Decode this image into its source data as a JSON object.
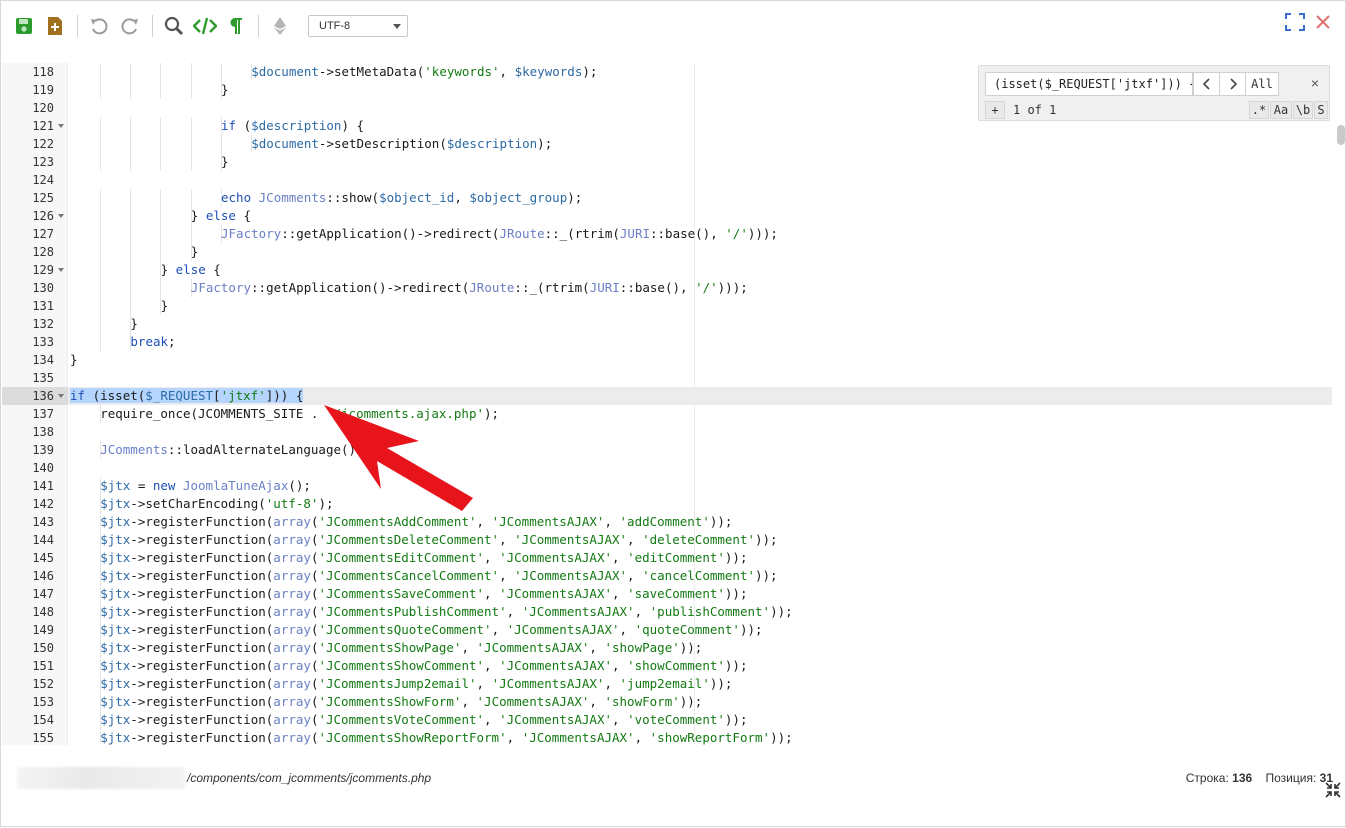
{
  "toolbar": {
    "save_icon": "save-icon",
    "new_file_icon": "new-file-icon",
    "undo_icon": "undo-icon",
    "redo_icon": "redo-icon",
    "search_icon": "search-icon",
    "code_icon": "code-icon",
    "pilcrow_icon": "pilcrow-icon",
    "encoding": "UTF-8",
    "colors": {
      "green": "#2e9b2e",
      "brown": "#a0701f",
      "gray": "#9a9a9a"
    }
  },
  "search": {
    "value": "(isset($_REQUEST['jtxf'])) {",
    "prev": "<",
    "next": ">",
    "all": "All",
    "close": "×",
    "add": "+",
    "counter": "1 of 1",
    "regex": ".*",
    "case": "Aa",
    "word": "\\b",
    "selection": "S"
  },
  "editor": {
    "lines": [
      {
        "n": "118",
        "fold": false,
        "indent": 6,
        "code": "$document->setMetaData('keywords', $keywords);"
      },
      {
        "n": "119",
        "fold": false,
        "indent": 5,
        "code": "}"
      },
      {
        "n": "120",
        "fold": false,
        "indent": 0,
        "code": ""
      },
      {
        "n": "121",
        "fold": true,
        "indent": 5,
        "code": "if ($description) {"
      },
      {
        "n": "122",
        "fold": false,
        "indent": 6,
        "code": "$document->setDescription($description);"
      },
      {
        "n": "123",
        "fold": false,
        "indent": 5,
        "code": "}"
      },
      {
        "n": "124",
        "fold": false,
        "indent": 0,
        "code": ""
      },
      {
        "n": "125",
        "fold": false,
        "indent": 5,
        "code": "echo JComments::show($object_id, $object_group);"
      },
      {
        "n": "126",
        "fold": true,
        "indent": 4,
        "code": "} else {"
      },
      {
        "n": "127",
        "fold": false,
        "indent": 5,
        "code": "JFactory::getApplication()->redirect(JRoute::_(rtrim(JURI::base(), '/')));"
      },
      {
        "n": "128",
        "fold": false,
        "indent": 4,
        "code": "}"
      },
      {
        "n": "129",
        "fold": true,
        "indent": 3,
        "code": "} else {"
      },
      {
        "n": "130",
        "fold": false,
        "indent": 4,
        "code": "JFactory::getApplication()->redirect(JRoute::_(rtrim(JURI::base(), '/')));"
      },
      {
        "n": "131",
        "fold": false,
        "indent": 3,
        "code": "}"
      },
      {
        "n": "132",
        "fold": false,
        "indent": 2,
        "code": "}"
      },
      {
        "n": "133",
        "fold": false,
        "indent": 2,
        "code": "break;"
      },
      {
        "n": "134",
        "fold": false,
        "indent": 0,
        "code": "}"
      },
      {
        "n": "135",
        "fold": false,
        "indent": 0,
        "code": ""
      },
      {
        "n": "136",
        "fold": true,
        "indent": 0,
        "code": "if (isset($_REQUEST['jtxf'])) {",
        "active": true
      },
      {
        "n": "137",
        "fold": false,
        "indent": 1,
        "code": "require_once(JCOMMENTS_SITE . '/jcomments.ajax.php');"
      },
      {
        "n": "138",
        "fold": false,
        "indent": 0,
        "code": ""
      },
      {
        "n": "139",
        "fold": false,
        "indent": 1,
        "code": "JComments::loadAlternateLanguage();"
      },
      {
        "n": "140",
        "fold": false,
        "indent": 0,
        "code": ""
      },
      {
        "n": "141",
        "fold": false,
        "indent": 1,
        "code": "$jtx = new JoomlaTuneAjax();"
      },
      {
        "n": "142",
        "fold": false,
        "indent": 1,
        "code": "$jtx->setCharEncoding('utf-8');"
      },
      {
        "n": "143",
        "fold": false,
        "indent": 1,
        "code": "$jtx->registerFunction(array('JCommentsAddComment', 'JCommentsAJAX', 'addComment'));"
      },
      {
        "n": "144",
        "fold": false,
        "indent": 1,
        "code": "$jtx->registerFunction(array('JCommentsDeleteComment', 'JCommentsAJAX', 'deleteComment'));"
      },
      {
        "n": "145",
        "fold": false,
        "indent": 1,
        "code": "$jtx->registerFunction(array('JCommentsEditComment', 'JCommentsAJAX', 'editComment'));"
      },
      {
        "n": "146",
        "fold": false,
        "indent": 1,
        "code": "$jtx->registerFunction(array('JCommentsCancelComment', 'JCommentsAJAX', 'cancelComment'));"
      },
      {
        "n": "147",
        "fold": false,
        "indent": 1,
        "code": "$jtx->registerFunction(array('JCommentsSaveComment', 'JCommentsAJAX', 'saveComment'));"
      },
      {
        "n": "148",
        "fold": false,
        "indent": 1,
        "code": "$jtx->registerFunction(array('JCommentsPublishComment', 'JCommentsAJAX', 'publishComment'));"
      },
      {
        "n": "149",
        "fold": false,
        "indent": 1,
        "code": "$jtx->registerFunction(array('JCommentsQuoteComment', 'JCommentsAJAX', 'quoteComment'));"
      },
      {
        "n": "150",
        "fold": false,
        "indent": 1,
        "code": "$jtx->registerFunction(array('JCommentsShowPage', 'JCommentsAJAX', 'showPage'));"
      },
      {
        "n": "151",
        "fold": false,
        "indent": 1,
        "code": "$jtx->registerFunction(array('JCommentsShowComment', 'JCommentsAJAX', 'showComment'));"
      },
      {
        "n": "152",
        "fold": false,
        "indent": 1,
        "code": "$jtx->registerFunction(array('JCommentsJump2email', 'JCommentsAJAX', 'jump2email'));"
      },
      {
        "n": "153",
        "fold": false,
        "indent": 1,
        "code": "$jtx->registerFunction(array('JCommentsShowForm', 'JCommentsAJAX', 'showForm'));"
      },
      {
        "n": "154",
        "fold": false,
        "indent": 1,
        "code": "$jtx->registerFunction(array('JCommentsVoteComment', 'JCommentsAJAX', 'voteComment'));"
      },
      {
        "n": "155",
        "fold": false,
        "indent": 1,
        "code": "$jtx->registerFunction(array('JCommentsShowReportForm', 'JCommentsAJAX', 'showReportForm'));"
      }
    ],
    "selection": "if (isset($_REQUEST['jtxf'])) {"
  },
  "statusbar": {
    "path": "/components/com_jcomments/jcomments.php",
    "line_label": "Строка:",
    "line_value": "136",
    "pos_label": "Позиция:",
    "pos_value": "31"
  },
  "annotation": {
    "arrow_color": "#e8141c"
  }
}
